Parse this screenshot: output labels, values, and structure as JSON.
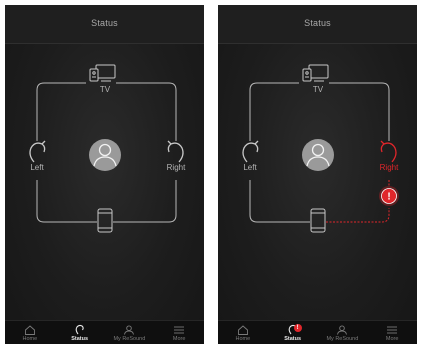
{
  "colors": {
    "background": "#1d1d1d",
    "line": "#b8b8b8",
    "alert": "#e0262b",
    "text": "#b3b3b3"
  },
  "screens": [
    {
      "header": {
        "title": "Status"
      },
      "devices": {
        "tv": "TV",
        "left": "Left",
        "right": "Right"
      },
      "alert_icon": null,
      "right_status": "connected",
      "tabs": [
        {
          "label": "Home",
          "icon": "home-icon",
          "active": false,
          "badge": ""
        },
        {
          "label": "Status",
          "icon": "hearing-aid-icon",
          "active": true,
          "badge": ""
        },
        {
          "label": "My ReSound",
          "icon": "person-icon",
          "active": false,
          "badge": ""
        },
        {
          "label": "More",
          "icon": "menu-icon",
          "active": false,
          "badge": ""
        }
      ]
    },
    {
      "header": {
        "title": "Status"
      },
      "devices": {
        "tv": "TV",
        "left": "Left",
        "right": "Right"
      },
      "alert_icon": "exclamation-icon",
      "alert_symbol": "!",
      "right_status": "disconnected",
      "tabs": [
        {
          "label": "Home",
          "icon": "home-icon",
          "active": false,
          "badge": ""
        },
        {
          "label": "Status",
          "icon": "hearing-aid-icon",
          "active": true,
          "badge": "!"
        },
        {
          "label": "My ReSound",
          "icon": "person-icon",
          "active": false,
          "badge": ""
        },
        {
          "label": "More",
          "icon": "menu-icon",
          "active": false,
          "badge": ""
        }
      ]
    }
  ]
}
